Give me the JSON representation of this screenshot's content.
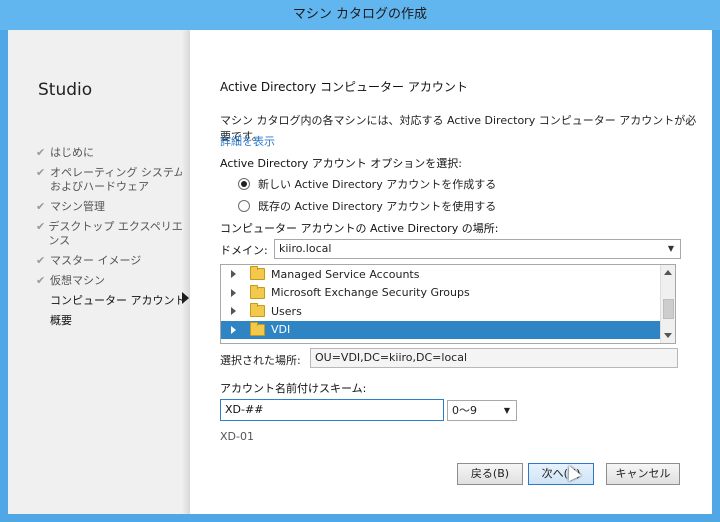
{
  "window": {
    "title": "マシン カタログの作成"
  },
  "sidebar": {
    "brand": "Studio",
    "steps": [
      {
        "label": "はじめに",
        "state": "done"
      },
      {
        "label": "オペレーティング システム\nおよびハードウェア",
        "state": "done"
      },
      {
        "label": "マシン管理",
        "state": "done"
      },
      {
        "label": "デスクトップ エクスペリエンス",
        "state": "done"
      },
      {
        "label": "マスター イメージ",
        "state": "done"
      },
      {
        "label": "仮想マシン",
        "state": "done"
      },
      {
        "label": "コンピューター アカウント",
        "state": "current"
      },
      {
        "label": "概要",
        "state": "pending"
      }
    ]
  },
  "main": {
    "heading": "Active Directory コンピューター アカウント",
    "description": "マシン カタログ内の各マシンには、対応する Active Directory コンピューター アカウントが必要です。",
    "details_link": "詳細を表示",
    "options_label": "Active Directory アカウント オプションを選択:",
    "radio_new": "新しい Active Directory アカウントを作成する",
    "radio_existing": "既存の Active Directory アカウントを使用する",
    "location_label": "コンピューター アカウントの Active Directory の場所:",
    "domain_label": "ドメイン:",
    "domain_value": "kiiro.local",
    "tree": [
      {
        "label": "Managed Service Accounts",
        "selected": false
      },
      {
        "label": "Microsoft Exchange Security Groups",
        "selected": false
      },
      {
        "label": "Users",
        "selected": false
      },
      {
        "label": "VDI",
        "selected": true
      }
    ],
    "selected_location_label": "選択された場所:",
    "selected_location_value": "OU=VDI,DC=kiiro,DC=local",
    "naming_label": "アカウント名前付けスキーム:",
    "naming_value": "XD-##",
    "naming_type": "0〜9",
    "preview": "XD-01"
  },
  "buttons": {
    "back": "戻る(B)",
    "next": "次へ(N)",
    "cancel": "キャンセル"
  }
}
